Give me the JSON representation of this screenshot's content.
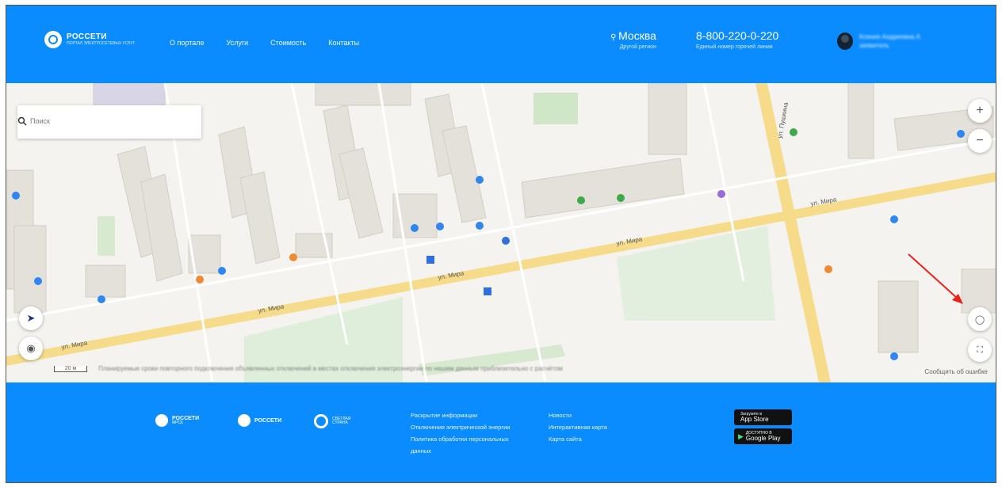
{
  "header": {
    "logo_name": "РОССЕТИ",
    "logo_sub": "ПОРТАЛ ЭЛЕКТРОСЕТЕВЫХ УСЛУГ",
    "nav": [
      "О портале",
      "Услуги",
      "Стоимость",
      "Контакты"
    ],
    "city": "Москва",
    "city_sub": "Другой регион",
    "phone": "8-800-220-0-220",
    "phone_sub": "Единый номер горячей линии",
    "user_name_line1": "Ксения Андреевна А",
    "user_name_line2": "заявитель"
  },
  "map": {
    "search_placeholder": "Поиск",
    "zoom_in": "+",
    "zoom_out": "−",
    "scale_label": "20 м",
    "attribution": "Планируемые сроки повторного подключения объявленных отключений в местах отключения электроэнергии по нашим данным приблизительно с расчётом",
    "yandex_label": "Сообщить об ошибке",
    "street_labels": [
      "ул. Мира",
      "ул. Мира",
      "ул. Мира",
      "ул. Мира",
      "ул. Мира",
      "ул. Пушкина"
    ]
  },
  "footer": {
    "logo1_name": "РОССЕТИ",
    "logo1_sub": "МРСК",
    "logo2_name": "РОССЕТИ",
    "logo3_name": "СВЕТЛАЯ СТРАНА",
    "col1": [
      "Раскрытие информации",
      "Отключения электрической энергии",
      "Политика обработки персональных данных"
    ],
    "col2": [
      "Новости",
      "Интерактивная карта",
      "Карта сайта"
    ],
    "store1_small": "Загрузите в",
    "store1_big": "App Store",
    "store2_small": "ДОСТУПНО В",
    "store2_big": "Google Play"
  },
  "colors": {
    "brand": "#0a8cff",
    "annotation_arrow": "#e8231a"
  }
}
